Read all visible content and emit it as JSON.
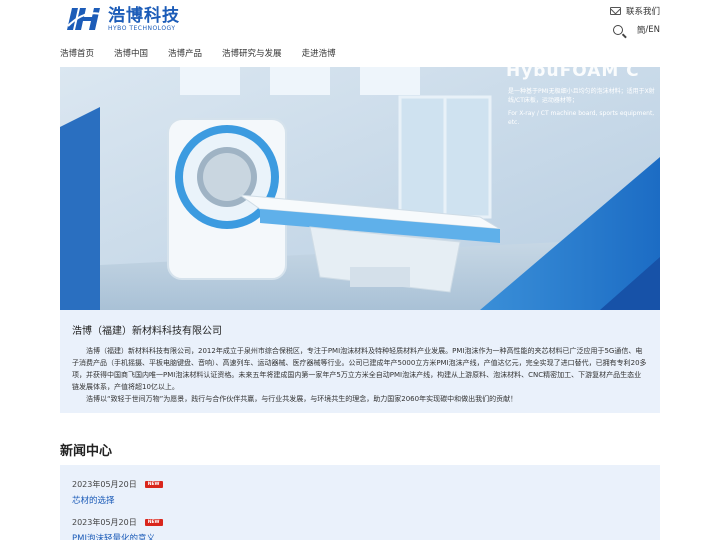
{
  "logo": {
    "name_cn": "浩博科技",
    "name_en": "HYBO TECHNOLOGY"
  },
  "header": {
    "contact_label": "联系我们",
    "lang_cn": "簡",
    "lang_sep": "/",
    "lang_en": "EN"
  },
  "nav": {
    "items": [
      {
        "label": "浩博首页"
      },
      {
        "label": "浩博中国"
      },
      {
        "label": "浩博产品"
      },
      {
        "label": "浩博研究与发展"
      },
      {
        "label": "走进浩博"
      }
    ]
  },
  "hero": {
    "product_name": "HybuFOAM C",
    "desc_cn": "是一种基于PMI无极细小且均匀的泡沫材料；适用于X射线/CT床板，运动器材等；",
    "desc_en": "For X-ray / CT machine board, sports equipment, etc."
  },
  "intro": {
    "title": "浩博（福建）新材料科技有限公司",
    "paragraph1": "浩博（福建）新材料科技有限公司，2012年成立于泉州市综合保税区，专注于PMI泡沫材料及特种轻质材料产业发展。PMI泡沫作为一种高性能的夹芯材料已广泛应用于5G通信、电子消费产品（手机摇摄、平板电脑键盘、音响）、高速列车、运动器械、医疗器械等行业。公司已建成年产5000立方米PMI泡沫产线，产值达亿元，完全实现了进口替代，已拥有专利20多项，并获得中国商飞国内唯一PMI泡沫材料认证资格。未来五年将建成国内第一家年产5万立方米全自动PMI泡沫产线，构建从上游原料、泡沫材料、CNC精密加工、下游复材产品生态业链发展体系，产值将超10亿以上。",
    "paragraph2": "浩博以“致轻于世间万物”为愿景，践行与合作伙伴共赢，与行业共发展，与环境共生的理念，助力国家2060年实现碳中和做出我们的贡献！"
  },
  "news": {
    "heading": "新闻中心",
    "badge": "NEW",
    "items": [
      {
        "date": "2023年05月20日",
        "title": "芯材的选择"
      },
      {
        "date": "2023年05月20日",
        "title": "PMI泡沫轻量化的意义"
      }
    ]
  },
  "colors": {
    "brand": "#1c5cb8",
    "badge": "#d9261c",
    "panel": "#eaf1fb"
  }
}
